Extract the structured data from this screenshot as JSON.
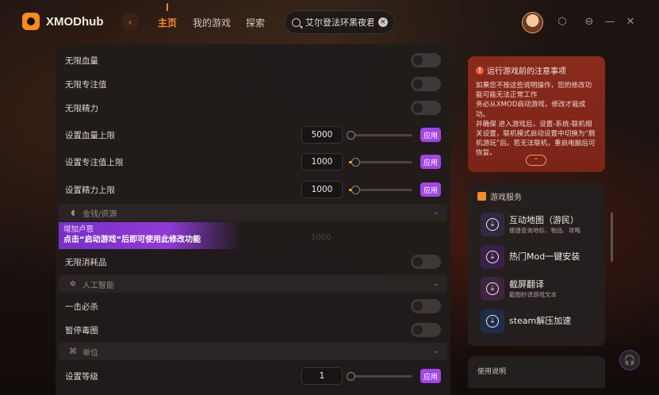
{
  "app": {
    "logo_text": "XMODhub"
  },
  "nav": {
    "back_glyph": "‹",
    "items": [
      {
        "label": "主页",
        "active": true
      },
      {
        "label": "我的游戏",
        "active": false
      },
      {
        "label": "探索",
        "active": false
      }
    ]
  },
  "search": {
    "value": "艾尔登法环黑夜君临",
    "icon": "search-icon",
    "clear_glyph": "×"
  },
  "window_controls": {
    "settings_glyph": "⬡",
    "minimize_glyph": "⊖",
    "restore_glyph": "—",
    "close_glyph": "✕"
  },
  "cheats": {
    "unlimited_hp": "无限血量",
    "unlimited_focus": "无限专注值",
    "unlimited_stamina": "无限精力",
    "set_hp_max": {
      "label": "设置血量上限",
      "value": "5000",
      "level": 0.0
    },
    "set_focus_max": {
      "label": "设置专注值上限",
      "value": "1000",
      "level": 0.08
    },
    "set_stamina_max": {
      "label": "设置精力上限",
      "value": "1000",
      "level": 0.08
    },
    "apply_label": "应用",
    "section_money": "金钱/资源",
    "tip_line1": "增加卢恩",
    "tip_line2": "点击“启动游戏”后即可使用此修改功能",
    "ghost_value": "1000",
    "unlimited_consumables": "无限消耗品",
    "section_ai": "人工智能",
    "one_hit_kill": "一击必杀",
    "pause_poison_ring": "暂停毒圈",
    "section_unit": "单位",
    "set_level": {
      "label": "设置等级",
      "value": "1",
      "level": 0.0
    }
  },
  "notice": {
    "title": "运行游戏前的注意事项",
    "icon_glyph": "!",
    "body": "如果您不按这些说明操作，您的修改功能可能无法正常工作\n务必从XMOD启动游戏，修改才能成功。\n并确保 进入游戏后，设置-系统-联机相关设置，联机模式启动设置中切换为“脱机游玩”后。若无法联机，重启电脑后可恢复。",
    "collapse_glyph": "⌃"
  },
  "services": {
    "title": "游戏服务",
    "items": [
      {
        "title": "互动地图（游民）",
        "subtitle": "便捷查询地标、物品、攻略",
        "color": "#2f2a40"
      },
      {
        "title": "热门Mod一键安装",
        "subtitle": "",
        "color": "#3a1f4a"
      },
      {
        "title": "截屏翻译",
        "subtitle": "截图秒译游戏文本",
        "color": "#3e2440"
      },
      {
        "title": "steam解压加速",
        "subtitle": "",
        "color": "#1e2c4a"
      }
    ],
    "item_glyph": "⇣"
  },
  "usage": {
    "title": "使用说明"
  },
  "support": {
    "glyph": "🎧"
  }
}
